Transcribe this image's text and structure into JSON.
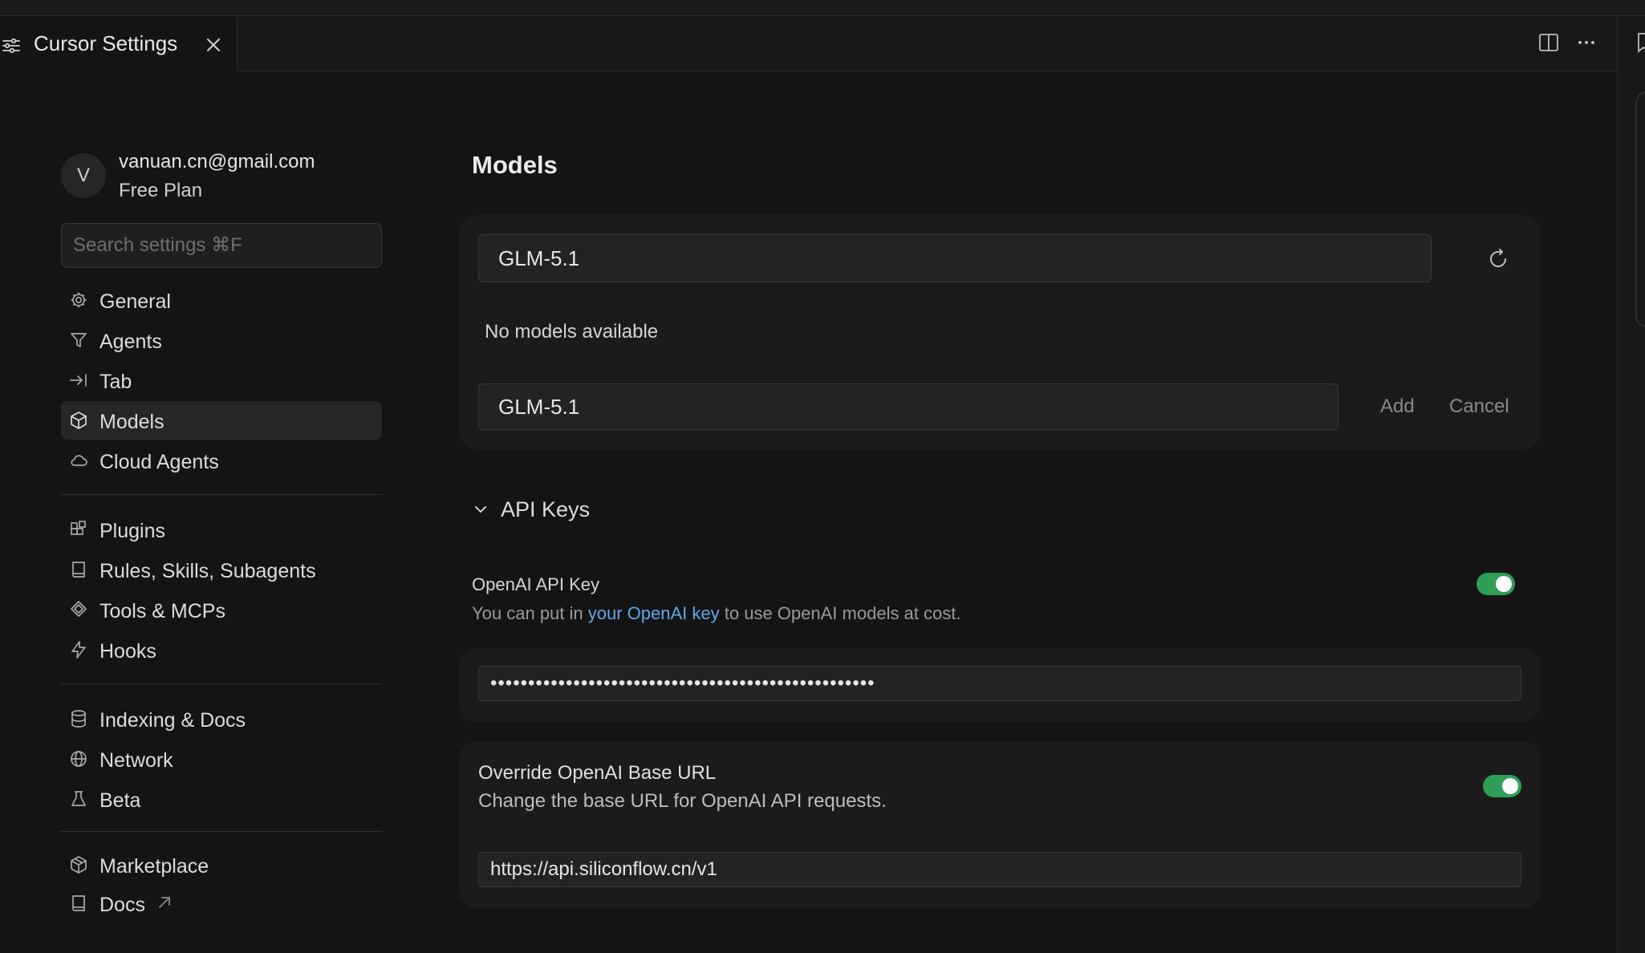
{
  "tab": {
    "title": "Cursor Settings",
    "icon": "sliders-icon"
  },
  "account": {
    "avatar_initial": "V",
    "email": "vanuan.cn@gmail.com",
    "plan": "Free Plan"
  },
  "search": {
    "placeholder": "Search settings ⌘F"
  },
  "sidebar": {
    "items": [
      {
        "label": "General",
        "icon": "gear-icon"
      },
      {
        "label": "Agents",
        "icon": "agents-icon"
      },
      {
        "label": "Tab",
        "icon": "tab-arrow-icon"
      },
      {
        "label": "Models",
        "icon": "cube-icon",
        "active": true
      },
      {
        "label": "Cloud Agents",
        "icon": "cloud-icon"
      },
      {
        "label": "Plugins",
        "icon": "plugins-icon"
      },
      {
        "label": "Rules, Skills, Subagents",
        "icon": "book-icon"
      },
      {
        "label": "Tools & MCPs",
        "icon": "tools-icon"
      },
      {
        "label": "Hooks",
        "icon": "lightning-icon"
      },
      {
        "label": "Indexing & Docs",
        "icon": "database-icon"
      },
      {
        "label": "Network",
        "icon": "globe-icon"
      },
      {
        "label": "Beta",
        "icon": "flask-icon"
      },
      {
        "label": "Marketplace",
        "icon": "package-icon"
      },
      {
        "label": "Docs",
        "icon": "book-icon",
        "external": true
      }
    ]
  },
  "models": {
    "heading": "Models",
    "search_value": "GLM-5.1",
    "empty_text": "No models available",
    "new_model_value": "GLM-5.1",
    "add_label": "Add",
    "cancel_label": "Cancel"
  },
  "api_keys": {
    "heading": "API Keys",
    "openai_label": "OpenAI API Key",
    "openai_desc_prefix": "You can put in",
    "openai_link": "your OpenAI key",
    "openai_desc_suffix": "to use OpenAI models at cost.",
    "openai_enabled": true,
    "openai_key_masked": "•••••••••••••••••••••••••••••••••••••••••••••••••••",
    "override_label": "Override OpenAI Base URL",
    "override_desc": "Change the base URL for OpenAI API requests.",
    "override_enabled": true,
    "base_url": "https://api.siliconflow.cn/v1"
  },
  "colors": {
    "background": "#141414",
    "card": "#1b1b1b",
    "toggle_on": "#2f9f57",
    "link": "#5fa8e8"
  }
}
